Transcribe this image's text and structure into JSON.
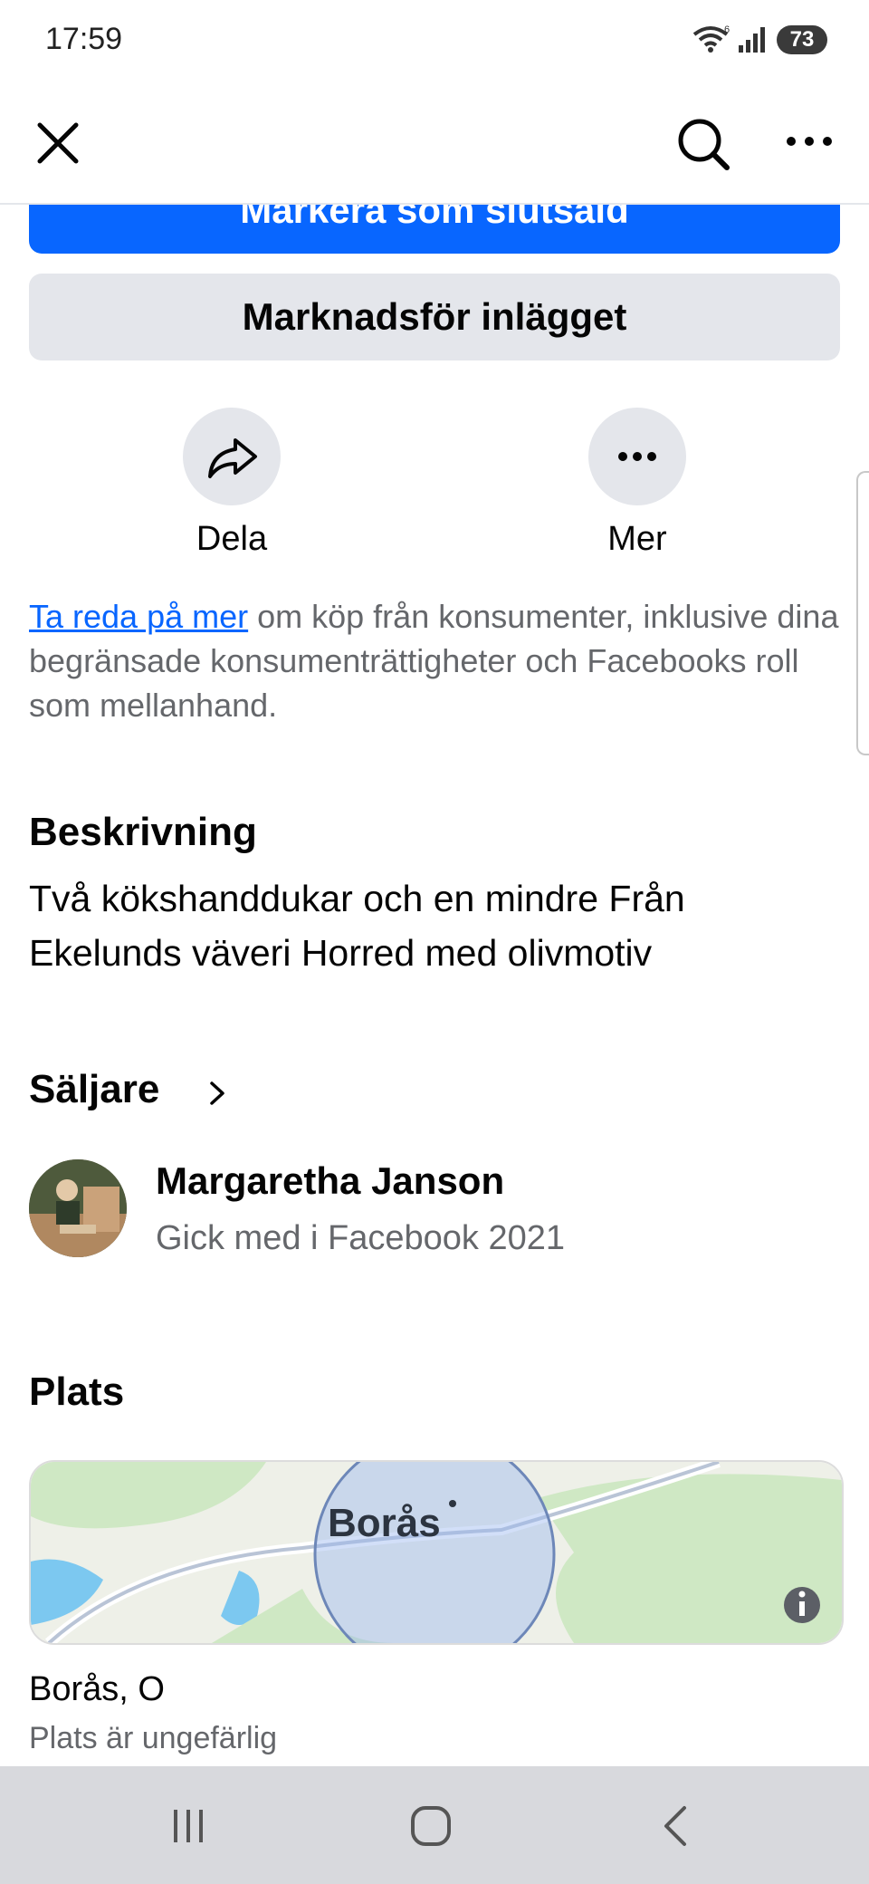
{
  "status_bar": {
    "time": "17:59",
    "battery": "73",
    "wifi_superscript": "6"
  },
  "header": {
    "close_icon": "close-icon",
    "search_icon": "search-icon",
    "more_icon": "more-horizontal-icon"
  },
  "actions": {
    "primary_label": "Markera som slutsåld",
    "promote_label": "Marknadsför inlägget",
    "share_label": "Dela",
    "more_label": "Mer"
  },
  "info": {
    "link_text": "Ta reda på mer",
    "rest_text": " om köp från konsumenter, inklusive dina begränsade konsumenträttigheter och Facebooks roll som mellanhand."
  },
  "description": {
    "heading": "Beskrivning",
    "text": "Två kökshanddukar och en mindre Från Ekelunds väveri Horred med olivmotiv"
  },
  "seller": {
    "heading": "Säljare",
    "name": "Margaretha Janson",
    "joined": "Gick med i Facebook 2021"
  },
  "location": {
    "heading": "Plats",
    "map_label": "Borås",
    "name": "Borås, O",
    "note": "Plats är ungefärlig"
  },
  "colors": {
    "accent": "#0866ff",
    "secondary_bg": "#e4e6eb",
    "muted_text": "#65676b",
    "map_green": "#cfe8c4",
    "map_water": "#7cc8f0"
  }
}
